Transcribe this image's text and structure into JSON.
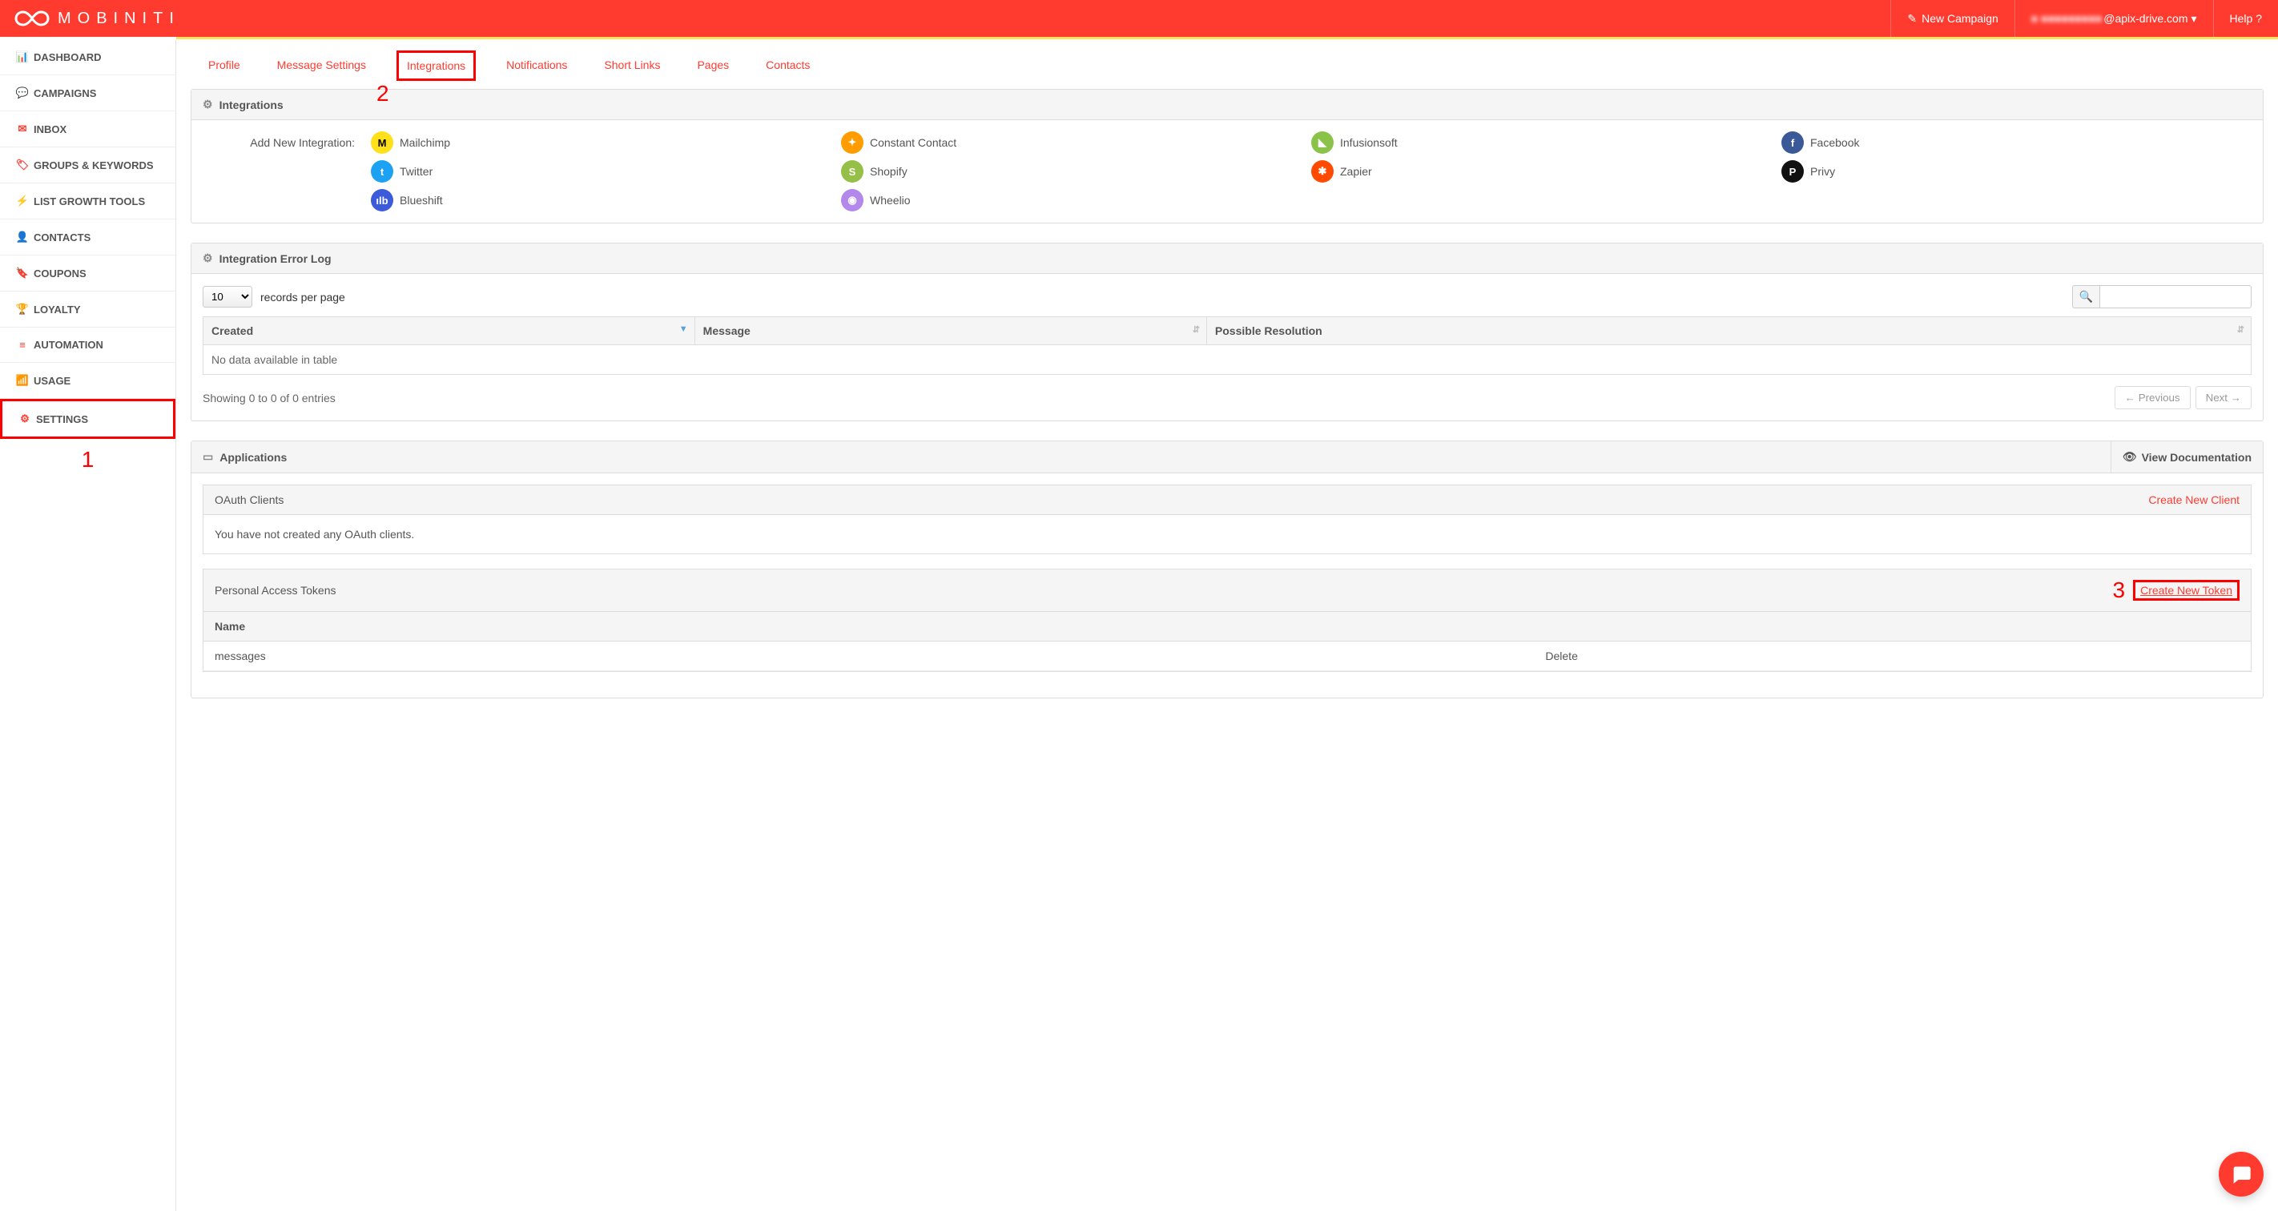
{
  "header": {
    "brand": "MOBINITI",
    "new_campaign": "New Campaign",
    "user_suffix": "@apix-drive.com",
    "user_blur": "■ ■■■■■■■■■",
    "help": "Help ?"
  },
  "sidebar": {
    "items": [
      {
        "icon": "📊",
        "label": "DASHBOARD"
      },
      {
        "icon": "💬",
        "label": "CAMPAIGNS"
      },
      {
        "icon": "✉",
        "label": "INBOX"
      },
      {
        "icon": "🏷",
        "label": "GROUPS & KEYWORDS"
      },
      {
        "icon": "⚡",
        "label": "LIST GROWTH TOOLS"
      },
      {
        "icon": "👤",
        "label": "CONTACTS"
      },
      {
        "icon": "🔖",
        "label": "COUPONS"
      },
      {
        "icon": "🏆",
        "label": "LOYALTY"
      },
      {
        "icon": "≡",
        "label": "AUTOMATION"
      },
      {
        "icon": "📶",
        "label": "USAGE"
      },
      {
        "icon": "⚙",
        "label": "SETTINGS"
      }
    ]
  },
  "tabs": [
    "Profile",
    "Message Settings",
    "Integrations",
    "Notifications",
    "Short Links",
    "Pages",
    "Contacts"
  ],
  "annotations": {
    "one": "1",
    "two": "2",
    "three": "3"
  },
  "panels": {
    "integrations": {
      "title": "Integrations",
      "add_label": "Add New Integration:",
      "list": [
        {
          "name": "Mailchimp",
          "bg": "#ffe01b",
          "abbr": "M",
          "fg": "#000"
        },
        {
          "name": "Constant Contact",
          "bg": "#ff9c00",
          "abbr": "✦"
        },
        {
          "name": "Infusionsoft",
          "bg": "#8bc34a",
          "abbr": "◣"
        },
        {
          "name": "Facebook",
          "bg": "#3b5998",
          "abbr": "f"
        },
        {
          "name": "Twitter",
          "bg": "#1da1f2",
          "abbr": "t"
        },
        {
          "name": "Shopify",
          "bg": "#95bf47",
          "abbr": "S"
        },
        {
          "name": "Zapier",
          "bg": "#ff4a00",
          "abbr": "✱"
        },
        {
          "name": "Privy",
          "bg": "#111",
          "abbr": "P"
        },
        {
          "name": "Blueshift",
          "bg": "#3b5bdb",
          "abbr": "ılb"
        },
        {
          "name": "Wheelio",
          "bg": "#b388eb",
          "abbr": "◉"
        }
      ]
    },
    "errorlog": {
      "title": "Integration Error Log",
      "records_value": "10",
      "records_label": "records per page",
      "cols": [
        "Created",
        "Message",
        "Possible Resolution"
      ],
      "empty": "No data available in table",
      "info": "Showing 0 to 0 of 0 entries",
      "prev": "← Previous",
      "next": "Next →"
    },
    "apps": {
      "title": "Applications",
      "view_docs": "View Documentation",
      "oauth": {
        "title": "OAuth Clients",
        "create": "Create New Client",
        "empty": "You have not created any OAuth clients."
      },
      "tokens": {
        "title": "Personal Access Tokens",
        "create": "Create New Token",
        "col_name": "Name",
        "rows": [
          {
            "name": "messages",
            "delete": "Delete"
          }
        ]
      }
    }
  }
}
